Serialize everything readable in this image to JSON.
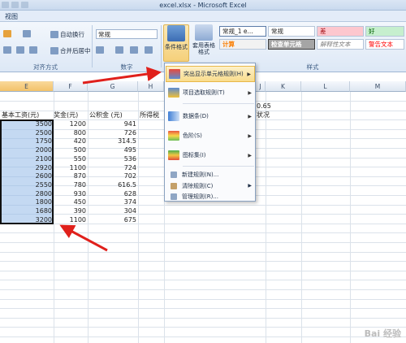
{
  "window": {
    "title": "excel.xlsx - Microsoft Excel"
  },
  "menu": {
    "tab": "视图"
  },
  "ribbon": {
    "wrap_text": "自动换行",
    "merge_center": "合并后居中",
    "number_format": "常规",
    "alignment_group": "对齐方式",
    "number_group": "数字",
    "styles_group": "样式",
    "conditional_format": "条件格式",
    "format_table": "套用表格格式",
    "styles": {
      "normal_1": "常规_1 e...",
      "normal": "常规",
      "bad": "差",
      "good": "好",
      "calculation": "计算",
      "check_cell": "检查单元格",
      "explanatory": "解释性文本",
      "warning": "警告文本"
    }
  },
  "columns": [
    "E",
    "F",
    "G",
    "H",
    "I",
    "J",
    "K",
    "L",
    "M"
  ],
  "headers": {
    "salary": "基本工资(元)",
    "bonus": "奖金(元)",
    "housing": "公积金 (元)",
    "tax": "所得税",
    "status": "状况",
    "j_value": "0.65"
  },
  "rows": [
    [
      "3500",
      "1200",
      "941"
    ],
    [
      "2500",
      "800",
      "726"
    ],
    [
      "1750",
      "420",
      "314.5"
    ],
    [
      "2000",
      "500",
      "495"
    ],
    [
      "2100",
      "550",
      "536"
    ],
    [
      "2920",
      "1100",
      "724"
    ],
    [
      "2600",
      "870",
      "702"
    ],
    [
      "2550",
      "780",
      "616.5"
    ],
    [
      "2800",
      "930",
      "628"
    ],
    [
      "1800",
      "450",
      "374"
    ],
    [
      "1680",
      "390",
      "304"
    ],
    [
      "3200",
      "1100",
      "675"
    ]
  ],
  "dropdown": {
    "items": [
      {
        "label": "突出显示单元格规则(H)",
        "has_submenu": true
      },
      {
        "label": "项目选取规则(T)",
        "has_submenu": true
      },
      {
        "label": "数据条(D)",
        "has_submenu": true
      },
      {
        "label": "色阶(S)",
        "has_submenu": true
      },
      {
        "label": "图标集(I)",
        "has_submenu": true
      }
    ],
    "small_items": [
      {
        "label": "新建规则(N)..."
      },
      {
        "label": "清除规则(C)",
        "has_submenu": true
      },
      {
        "label": "管理规则(R)..."
      }
    ]
  },
  "watermark": "Bai 经验"
}
